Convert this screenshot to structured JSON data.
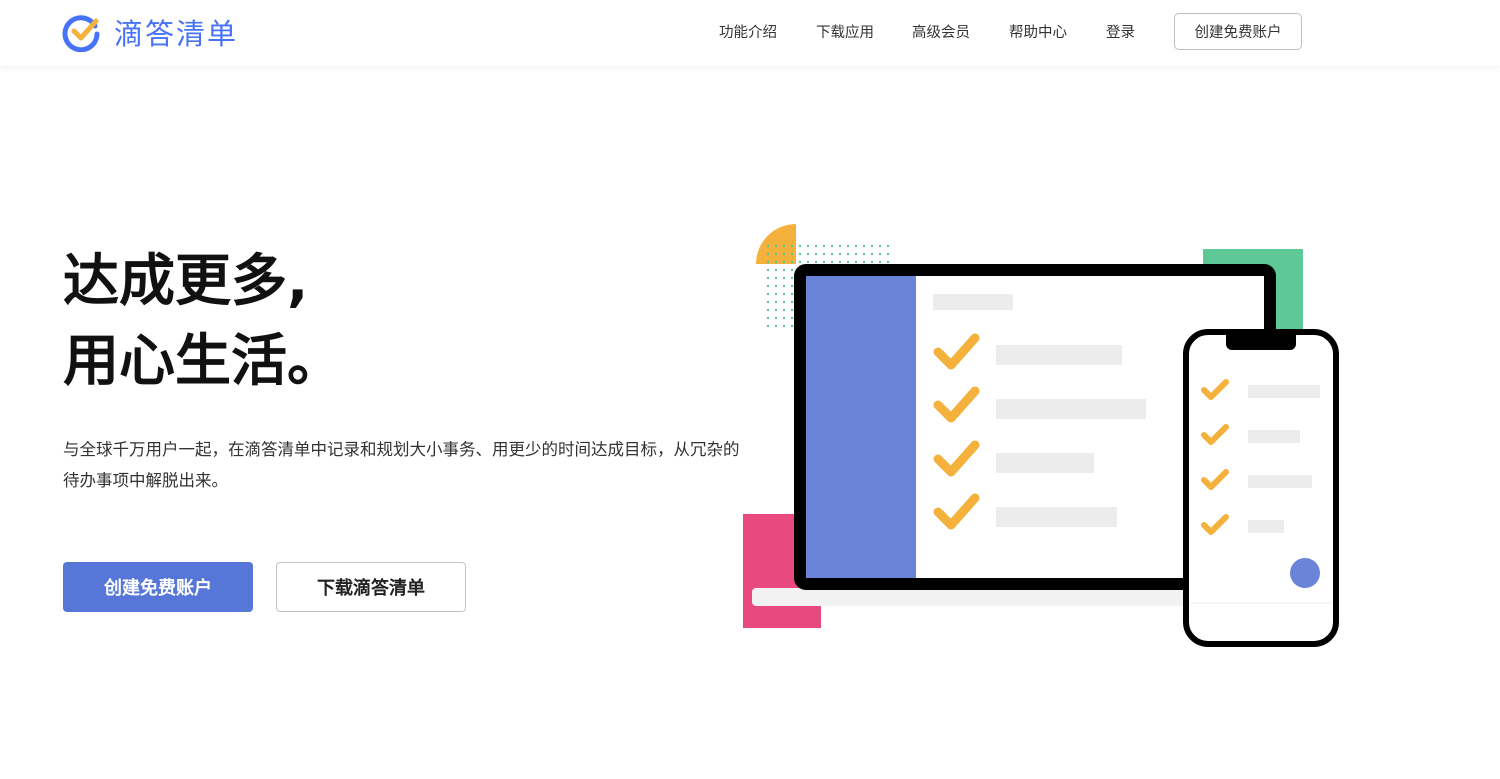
{
  "header": {
    "brand": "滴答清单",
    "nav": [
      "功能介绍",
      "下载应用",
      "高级会员",
      "帮助中心",
      "登录"
    ],
    "cta_label": "创建免费账户"
  },
  "hero": {
    "title_line1": "达成更多,",
    "title_line2": "用心生活。",
    "description": "与全球千万用户一起，在滴答清单中记录和规划大小事务、用更少的时间达成目标，从冗杂的待办事项中解脱出来。",
    "primary_button": "创建免费账户",
    "secondary_button": "下载滴答清单"
  },
  "colors": {
    "brand_blue": "#4772fa",
    "button_blue": "#5677d8",
    "check_orange": "#f4b13c",
    "sidebar_blue": "#6a84d8",
    "accent_green": "#5ec896",
    "accent_pink": "#e84a7f"
  }
}
